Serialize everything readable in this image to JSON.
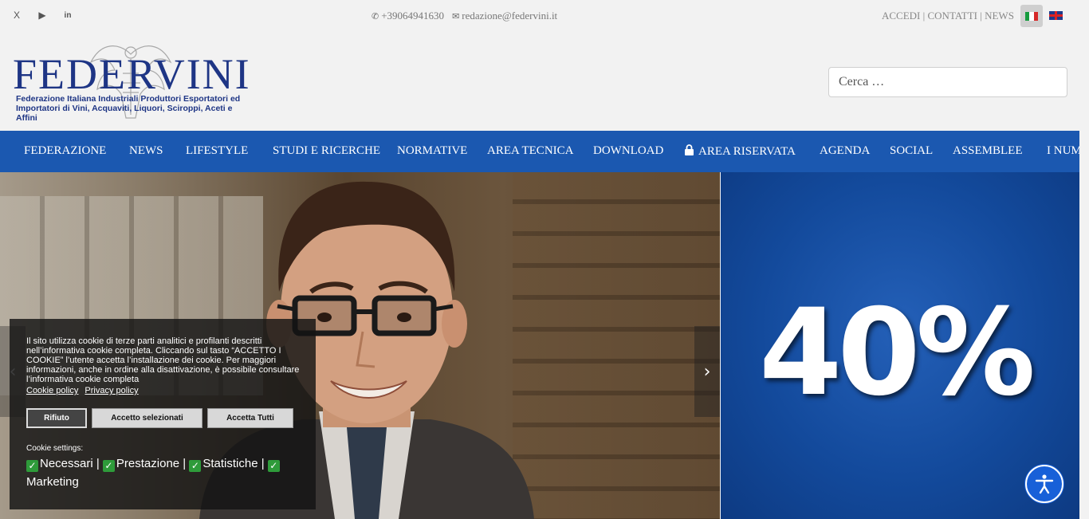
{
  "topbar": {
    "social": [
      {
        "name": "x-icon",
        "glyph": "X"
      },
      {
        "name": "youtube-icon",
        "glyph": "▶"
      },
      {
        "name": "linkedin-icon",
        "glyph": "in"
      }
    ],
    "phone": "+39064941630",
    "email": "redazione@federvini.it",
    "links": "ACCEDI | CONTATTI | NEWS",
    "languages": [
      "it",
      "en"
    ]
  },
  "header": {
    "logo_word": "FEDERVINI",
    "logo_sub_1": "Federazione Italiana Industriali Produttori Esportatori ed",
    "logo_sub_2": "Importatori di Vini, Acquaviti, Liquori, Sciroppi, Aceti e Affini",
    "search_placeholder": "Cerca …"
  },
  "nav": {
    "items": [
      "FEDERAZIONE",
      "NEWS",
      "LIFESTYLE",
      "STUDI E RICERCHE",
      "NORMATIVE",
      "AREA TECNICA",
      "DOWNLOAD",
      "AREA RISERVATA",
      "AGENDA",
      "SOCIAL",
      "ASSEMBLEE",
      "I NUM"
    ]
  },
  "slider": {
    "prev": "‹",
    "next": "›"
  },
  "banner": {
    "text": "40%"
  },
  "cookie": {
    "text": "Il sito utilizza cookie di terze parti analitici e profilanti descritti nell’informativa cookie completa. Cliccando sul tasto “ACCETTO I COOKIE” l’utente accetta l’installazione dei cookie. Per maggiori informazioni, anche in ordine alla disattivazione, è possibile consultare l’informativa cookie completa",
    "link_policy": "Cookie policy",
    "link_privacy": "Privacy policy",
    "btn_reject": "Rifiuto",
    "btn_selected": "Accetto selezionati",
    "btn_all": "Accetta Tutti",
    "settings_label": "Cookie settings:",
    "options": [
      "Necessari",
      "Prestazione",
      "Statistiche",
      "Marketing"
    ]
  },
  "colors": {
    "nav_bg": "#1b58b0",
    "brand": "#1e3585",
    "banner": "#134a9c",
    "accessibility": "#1860d8"
  }
}
